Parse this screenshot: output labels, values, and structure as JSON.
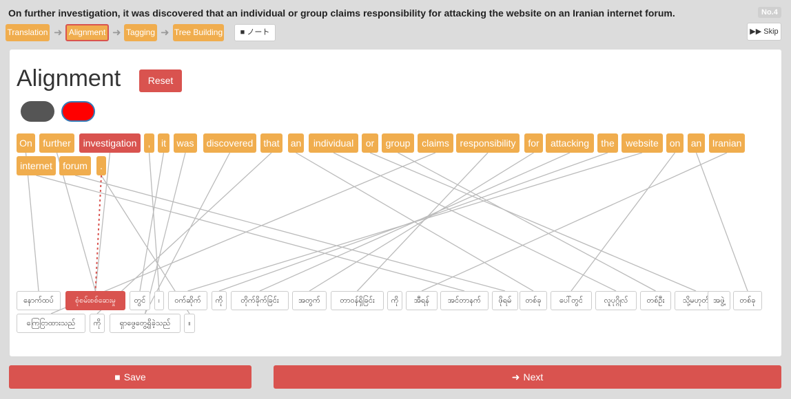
{
  "header": {
    "sentence": "On further investigation, it was discovered that an individual or group claims responsibility for attacking the website on an Iranian internet forum.",
    "sentence_number": "No.4"
  },
  "steps": [
    {
      "label": "Translation",
      "active": false
    },
    {
      "label": "Alignment",
      "active": true
    },
    {
      "label": "Tagging",
      "active": false
    },
    {
      "label": "Tree Building",
      "active": false
    }
  ],
  "step_arrow": "➜",
  "note_button": {
    "icon": "comment-icon",
    "label": "ノート"
  },
  "skip_button": {
    "icon": "fast-forward-icon",
    "label": "Skip"
  },
  "panel": {
    "title": "Alignment",
    "reset_label": "Reset"
  },
  "colors": {
    "token": "#f0ad4e",
    "selected": "#d9534f",
    "line": "#bbbbbb",
    "button": "#d9534f"
  },
  "source_tokens": [
    "On",
    "further",
    "investigation",
    ",",
    "it",
    "was",
    "discovered",
    "that",
    "an",
    "individual",
    "or",
    "group",
    "claims",
    "responsibility",
    "for",
    "attacking",
    "the",
    "website",
    "on",
    "an",
    "Iranian",
    "internet",
    "forum",
    "."
  ],
  "selected_source": 2,
  "target_tokens": [
    "နောက်ထပ်",
    "စုံစမ်းစစ်ဆေးမှု",
    "တွင်",
    "၊",
    "ဝက်ဆိုက်",
    "ကို",
    "တိုက်ခိုက်ခြင်း",
    "အတွက်",
    "တာဝန်ရှိခြင်း",
    "ကို",
    "အီရန်",
    "အင်တာနက်",
    "ဖိုရမ်",
    "တစ်ခု",
    "ပေါ်တွင်",
    "လူပုဂ္ဂိုလ်",
    "တစ်ဦး",
    "သို့မဟုတ်",
    "အဖွဲ့",
    "တစ်ခု",
    "ကြေငြာထားသည်",
    "ကို",
    "ရှာဖွေတွေ့ရှိခဲ့သည်",
    "။"
  ],
  "selected_target": 1,
  "alignments": [
    [
      0,
      0
    ],
    [
      1,
      1
    ],
    [
      2,
      1
    ],
    [
      3,
      3
    ],
    [
      4,
      2
    ],
    [
      5,
      22
    ],
    [
      6,
      22
    ],
    [
      7,
      21
    ],
    [
      8,
      13
    ],
    [
      9,
      15
    ],
    [
      10,
      17
    ],
    [
      11,
      16
    ],
    [
      12,
      20
    ],
    [
      13,
      8
    ],
    [
      14,
      7
    ],
    [
      15,
      6
    ],
    [
      16,
      5
    ],
    [
      17,
      4
    ],
    [
      18,
      14
    ],
    [
      19,
      19
    ],
    [
      20,
      10
    ],
    [
      21,
      11
    ],
    [
      22,
      12
    ],
    [
      23,
      23
    ]
  ],
  "dashed_alignment": [
    23,
    1
  ],
  "save_button": {
    "icon": "floppy-icon",
    "label": "Save"
  },
  "next_button": {
    "icon": "arrow-right-icon",
    "label": "Next"
  }
}
